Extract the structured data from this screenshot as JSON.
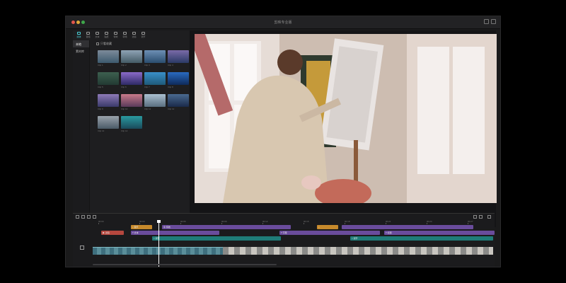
{
  "window": {
    "title": "剪映专业版"
  },
  "toolbar": {
    "items": [
      {
        "label": "媒体",
        "icon": "media-icon"
      },
      {
        "label": "音频",
        "icon": "audio-icon"
      },
      {
        "label": "文本",
        "icon": "text-icon"
      },
      {
        "label": "贴纸",
        "icon": "sticker-icon"
      },
      {
        "label": "特效",
        "icon": "effects-icon"
      },
      {
        "label": "转场",
        "icon": "transition-icon"
      },
      {
        "label": "滤镜",
        "icon": "filter-icon"
      },
      {
        "label": "调节",
        "icon": "adjust-icon"
      }
    ]
  },
  "sidebar": {
    "items": [
      {
        "label": "本地"
      },
      {
        "label": "素材库"
      }
    ]
  },
  "media": {
    "filter_label": "只看收藏",
    "thumbnails": [
      {
        "caption": "Clip 1",
        "colors": [
          "#7c8a9a",
          "#3d5a6e"
        ]
      },
      {
        "caption": "Clip 2",
        "colors": [
          "#8fa3b5",
          "#445b66"
        ]
      },
      {
        "caption": "Clip 3",
        "colors": [
          "#6d8fb5",
          "#2a4d6e"
        ]
      },
      {
        "caption": "Clip 4",
        "colors": [
          "#7a6aa8",
          "#2b3a66"
        ]
      },
      {
        "caption": "Clip 5",
        "colors": [
          "#3d5f4f",
          "#223a33"
        ]
      },
      {
        "caption": "Clip 6",
        "colors": [
          "#8a6ac8",
          "#2e2a66"
        ]
      },
      {
        "caption": "Clip 7",
        "colors": [
          "#3a8fc8",
          "#1e5a7a"
        ]
      },
      {
        "caption": "Clip 8",
        "colors": [
          "#2a6ac0",
          "#0e2a5a"
        ]
      },
      {
        "caption": "Clip 9",
        "colors": [
          "#8e7ab8",
          "#3a3a6a"
        ]
      },
      {
        "caption": "Clip 10",
        "colors": [
          "#c87a8a",
          "#5a3a5a"
        ]
      },
      {
        "caption": "Clip 11",
        "colors": [
          "#aac0d0",
          "#5a6f80"
        ]
      },
      {
        "caption": "Clip 12",
        "colors": [
          "#4a6a90",
          "#1a2a4a"
        ]
      },
      {
        "caption": "Clip 13",
        "colors": [
          "#9aa3ac",
          "#4a5a66"
        ]
      },
      {
        "caption": "Clip 14",
        "colors": [
          "#2a9aa0",
          "#1a4a5a"
        ]
      }
    ]
  },
  "player": {
    "current_time": "00:00:00",
    "total_time": "00:00:15",
    "ratio": "原始"
  },
  "timeline": {
    "ticks": [
      "00:00",
      "00:03",
      "00:06",
      "00:09",
      "00:12",
      "00:15",
      "00:18",
      "00:21",
      "00:24",
      "00:27"
    ],
    "clips": {
      "orange1": "♪ 音乐",
      "orange2": "♪",
      "purple1": "❖ 特效",
      "red1": "▶ 滤镜",
      "purple2": "T 文本",
      "purple3": "T 字幕",
      "purple4": "T 标题",
      "teal1": "≈ 调节",
      "teal2": "≈ 调节"
    }
  }
}
